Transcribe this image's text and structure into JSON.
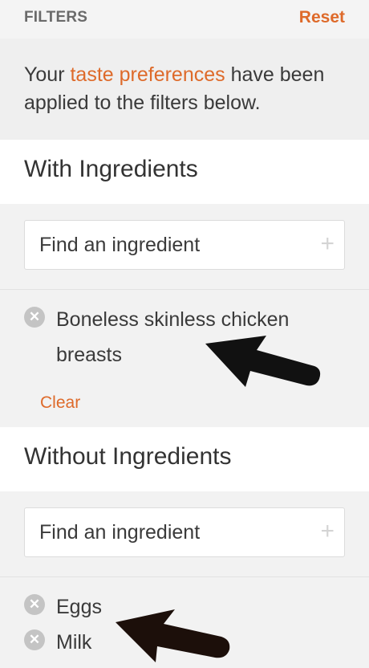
{
  "header": {
    "title": "FILTERS",
    "reset_label": "Reset"
  },
  "notice": {
    "before": "Your ",
    "link": "taste preferences",
    "after": " have been applied to the filters below."
  },
  "with_section": {
    "title": "With Ingredients",
    "search_placeholder": "Find an ingredient",
    "items": [
      {
        "label": "Boneless skinless chicken breasts"
      }
    ],
    "clear_label": "Clear"
  },
  "without_section": {
    "title": "Without Ingredients",
    "search_placeholder": "Find an ingredient",
    "items": [
      {
        "label": "Eggs"
      },
      {
        "label": "Milk"
      }
    ]
  },
  "icons": {
    "add": "plus-icon",
    "remove": "close-circle-icon",
    "annotation": "arrow-icon"
  },
  "colors": {
    "accent": "#de6a2a",
    "chip_icon": "#c4c4c4",
    "annotation_arrow": "#111111"
  }
}
